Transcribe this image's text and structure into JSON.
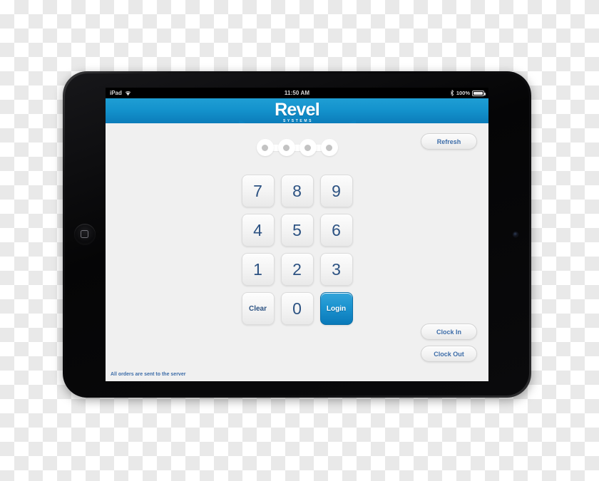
{
  "status_bar": {
    "device_label": "iPad",
    "wifi_icon": "wifi-icon",
    "time": "11:50 AM",
    "bluetooth_icon": "bluetooth-icon",
    "battery_percent": "100%",
    "battery_icon": "battery-icon"
  },
  "branding": {
    "logo_name": "Revel",
    "logo_tagline": "SYSTEMS",
    "accent_color": "#1493cd",
    "link_color": "#3c6ca8",
    "digit_color": "#2c5282"
  },
  "pin": {
    "dots": [
      "pin-dot-1",
      "pin-dot-2",
      "pin-dot-3",
      "pin-dot-4"
    ],
    "entered_count": 0
  },
  "keypad": {
    "keys": [
      {
        "label": "7",
        "name": "key-7",
        "style": "digit"
      },
      {
        "label": "8",
        "name": "key-8",
        "style": "digit"
      },
      {
        "label": "9",
        "name": "key-9",
        "style": "digit"
      },
      {
        "label": "4",
        "name": "key-4",
        "style": "digit"
      },
      {
        "label": "5",
        "name": "key-5",
        "style": "digit"
      },
      {
        "label": "6",
        "name": "key-6",
        "style": "digit"
      },
      {
        "label": "1",
        "name": "key-1",
        "style": "digit"
      },
      {
        "label": "2",
        "name": "key-2",
        "style": "digit"
      },
      {
        "label": "3",
        "name": "key-3",
        "style": "digit"
      },
      {
        "label": "Clear",
        "name": "clear-button",
        "style": "small"
      },
      {
        "label": "0",
        "name": "key-0",
        "style": "digit"
      },
      {
        "label": "Login",
        "name": "login-button",
        "style": "primary"
      }
    ]
  },
  "side_buttons": {
    "refresh": "Refresh",
    "clock_in": "Clock In",
    "clock_out": "Clock Out"
  },
  "footer": {
    "note": "All orders are sent to the server"
  }
}
